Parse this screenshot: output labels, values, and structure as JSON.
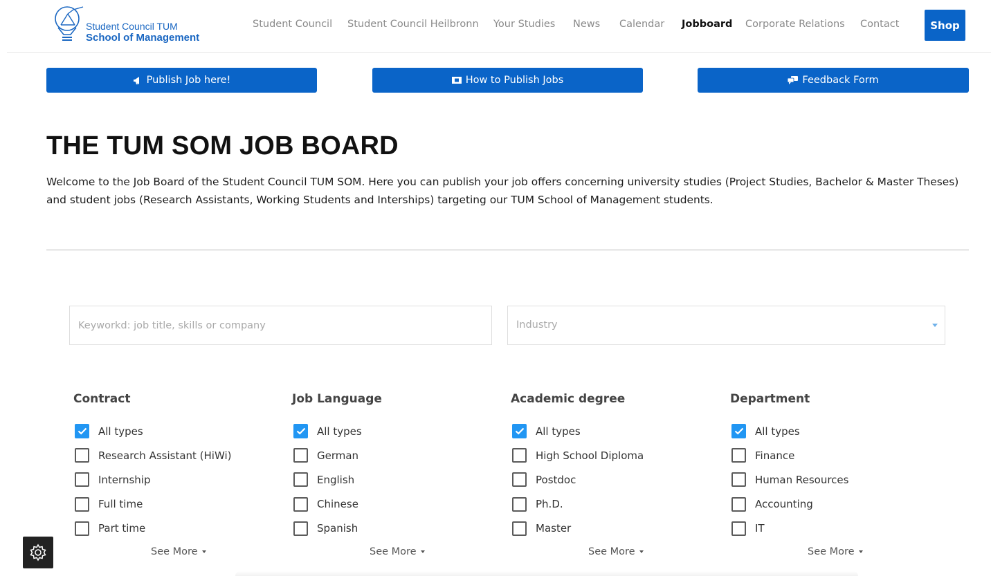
{
  "header": {
    "logo": {
      "line1": "Student Council TUM",
      "line2": "School of Management"
    },
    "nav": [
      {
        "label": "Student Council",
        "active": false
      },
      {
        "label": "Student Council Heilbronn",
        "active": false
      },
      {
        "label": "Your Studies",
        "active": false
      },
      {
        "label": "News",
        "active": false
      },
      {
        "label": "Calendar",
        "active": false
      },
      {
        "label": "Jobboard",
        "active": true
      },
      {
        "label": "Corporate Relations",
        "active": false
      },
      {
        "label": "Contact",
        "active": false
      }
    ],
    "shop_label": "Shop"
  },
  "actions": [
    {
      "label": "Publish Job here!",
      "icon": "megaphone-icon"
    },
    {
      "label": "How to Publish Jobs",
      "icon": "ticket-icon"
    },
    {
      "label": "Feedback Form",
      "icon": "chat-bubbles-icon"
    }
  ],
  "main": {
    "title": "THE TUM SOM JOB BOARD",
    "intro": "Welcome to the Job Board of the Student Council TUM SOM. Here you can publish your job offers concerning university studies (Project Studies, Bachelor & Master Theses) and student jobs (Research Assistants, Working Students and Interships) targeting our TUM School of Management students."
  },
  "search": {
    "keyword_placeholder": "Keyworkd: job title, skills or company",
    "keyword_value": "",
    "industry_placeholder": "Industry"
  },
  "filters": [
    {
      "title": "Contract",
      "items": [
        {
          "label": "All types",
          "checked": true
        },
        {
          "label": "Research Assistant (HiWi)",
          "checked": false
        },
        {
          "label": "Internship",
          "checked": false
        },
        {
          "label": "Full time",
          "checked": false
        },
        {
          "label": "Part time",
          "checked": false
        }
      ],
      "see_more": "See More"
    },
    {
      "title": "Job Language",
      "items": [
        {
          "label": "All types",
          "checked": true
        },
        {
          "label": "German",
          "checked": false
        },
        {
          "label": "English",
          "checked": false
        },
        {
          "label": "Chinese",
          "checked": false
        },
        {
          "label": "Spanish",
          "checked": false
        }
      ],
      "see_more": "See More"
    },
    {
      "title": "Academic degree",
      "items": [
        {
          "label": "All types",
          "checked": true
        },
        {
          "label": "High School Diploma",
          "checked": false
        },
        {
          "label": "Postdoc",
          "checked": false
        },
        {
          "label": "Ph.D.",
          "checked": false
        },
        {
          "label": "Master",
          "checked": false
        }
      ],
      "see_more": "See More"
    },
    {
      "title": "Department",
      "items": [
        {
          "label": "All types",
          "checked": true
        },
        {
          "label": "Finance",
          "checked": false
        },
        {
          "label": "Human Resources",
          "checked": false
        },
        {
          "label": "Accounting",
          "checked": false
        },
        {
          "label": "IT",
          "checked": false
        }
      ],
      "see_more": "See More"
    }
  ],
  "colors": {
    "brand_blue": "#0a64c8",
    "checkbox_blue": "#2196f3"
  },
  "settings_icon": "gear-icon"
}
